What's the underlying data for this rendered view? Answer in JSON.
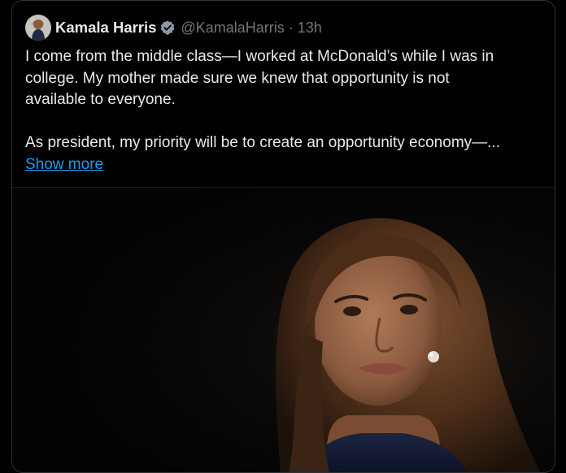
{
  "tweet": {
    "author_name": "Kamala Harris",
    "author_handle": "@KamalaHarris",
    "separator": "·",
    "timestamp": "13h",
    "verified": true,
    "text_lines": [
      "I come from the middle class—I worked at McDonald’s while I was in",
      "college. My mother made sure we knew that opportunity is not",
      "available to everyone."
    ],
    "text_paragraph_2": "As president, my priority will be to create an opportunity economy—...",
    "show_more_label": "Show more",
    "media_alt": "Photo of Kamala Harris"
  },
  "colors": {
    "background": "#000000",
    "text": "#e7e9ea",
    "muted": "#71767b",
    "link": "#1d9bf0",
    "verified_badge": "#8b98a5",
    "border": "#2f3336"
  },
  "icons": {
    "verified": "verified-badge-icon",
    "avatar": "avatar-image"
  }
}
